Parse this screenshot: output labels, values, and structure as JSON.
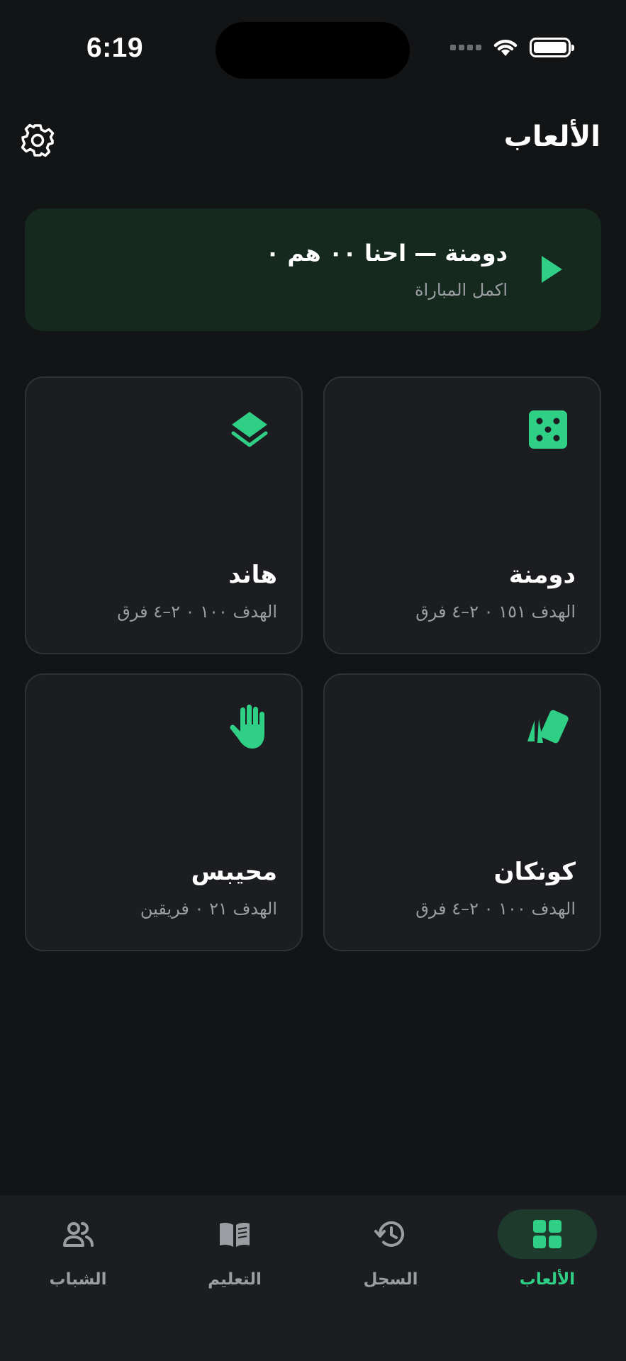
{
  "status_bar": {
    "time": "6:19"
  },
  "header": {
    "title": "الألعاب"
  },
  "resume": {
    "title": "دومنة — احنا ٠٠ هم ٠",
    "subtitle": "اكمل المباراة"
  },
  "games": [
    {
      "name": "دومنة",
      "meta": "الهدف ١٥١ ٠ ٢–٤ فرق",
      "icon": "dice-icon"
    },
    {
      "name": "هاند",
      "meta": "الهدف ١٠٠ ٠ ٢–٤ فرق",
      "icon": "layers-icon"
    },
    {
      "name": "كونكان",
      "meta": "الهدف ١٠٠ ٠ ٢–٤ فرق",
      "icon": "cards-icon"
    },
    {
      "name": "محيبس",
      "meta": "الهدف ٢١ ٠ فريقين",
      "icon": "hand-icon"
    }
  ],
  "nav": {
    "items": [
      {
        "label": "الألعاب",
        "icon": "grid-icon",
        "active": true
      },
      {
        "label": "السجل",
        "icon": "history-icon",
        "active": false
      },
      {
        "label": "التعليم",
        "icon": "book-icon",
        "active": false
      },
      {
        "label": "الشباب",
        "icon": "people-icon",
        "active": false
      }
    ]
  },
  "colors": {
    "accent": "#2fcf86",
    "background": "#131416",
    "card": "#1c1d20",
    "resume_card": "#15291f",
    "muted_text": "#9a9da2"
  }
}
